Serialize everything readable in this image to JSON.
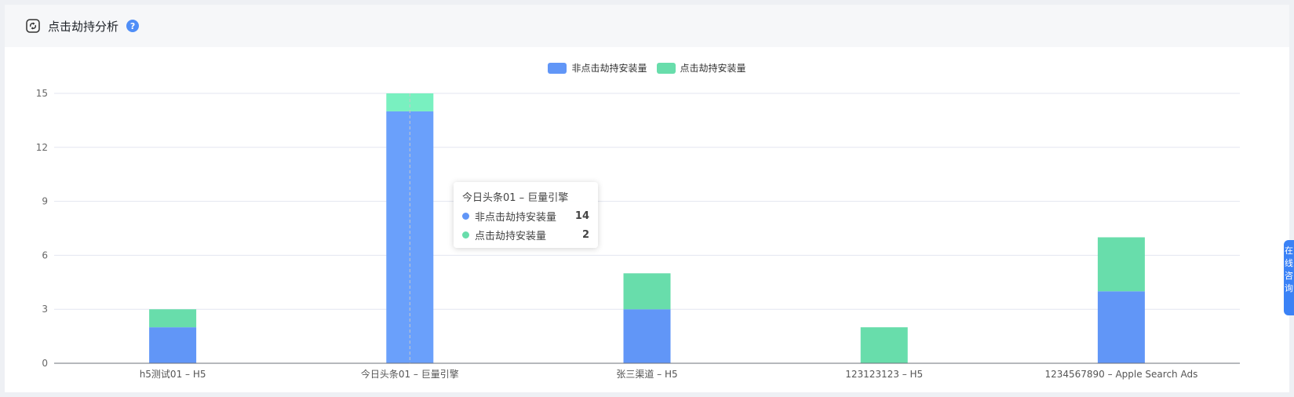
{
  "header": {
    "title": "点击劫持分析",
    "help_glyph": "?"
  },
  "colors": {
    "series_non_hijack": "#6196f7",
    "series_hijack": "#68ddab",
    "tooltip_hover_bar": "#6aa0fb",
    "tooltip_hover_top": "#79f0c0"
  },
  "chart_data": {
    "type": "bar",
    "stacked": true,
    "categories": [
      "h5测试01 – H5",
      "今日头条01 – 巨量引擎",
      "张三渠道 – H5",
      "123123123 – H5",
      "1234567890 – Apple Search Ads"
    ],
    "series": [
      {
        "name": "非点击劫持安装量",
        "values": [
          2,
          14,
          3,
          0,
          4
        ]
      },
      {
        "name": "点击劫持安装量",
        "values": [
          1,
          1,
          2,
          2,
          3
        ]
      }
    ],
    "ylim": [
      0,
      15
    ],
    "yticks": [
      0,
      3,
      6,
      9,
      12,
      15
    ],
    "grid": true,
    "legend": "top-center"
  },
  "tooltip": {
    "title": "今日头条01 – 巨量引擎",
    "rows": [
      {
        "name": "非点击劫持安装量",
        "value": "14"
      },
      {
        "name": "点击劫持安装量",
        "value": "2"
      }
    ]
  },
  "side_tab": {
    "chars": [
      "在",
      "线",
      "咨",
      "询"
    ]
  }
}
